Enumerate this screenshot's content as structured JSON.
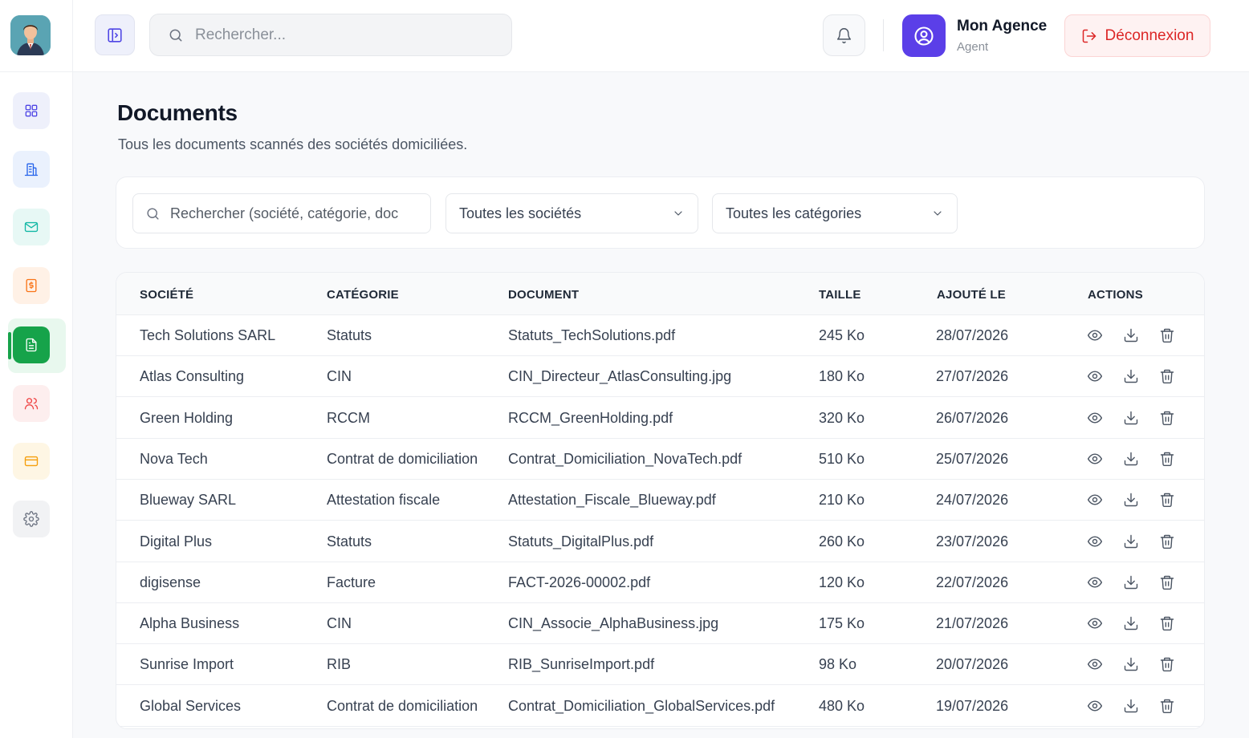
{
  "header": {
    "search_placeholder": "Rechercher...",
    "user_name": "Mon Agence",
    "user_role": "Agent",
    "logout_label": "Déconnexion"
  },
  "sidebar": {
    "items": [
      {
        "name": "dashboard",
        "icon": "grid-icon",
        "color": "#4f46e5",
        "bg": "#eef0fb"
      },
      {
        "name": "companies",
        "icon": "building-icon",
        "color": "#2563eb",
        "bg": "#eaf1fd"
      },
      {
        "name": "mail",
        "icon": "mail-icon",
        "color": "#14b8a6",
        "bg": "#e7f8f5"
      },
      {
        "name": "invoices",
        "icon": "dollar-doc-icon",
        "color": "#f97316",
        "bg": "#fff1e6"
      },
      {
        "name": "documents",
        "icon": "document-icon",
        "color": "#ffffff",
        "bg": "#16a34a",
        "active": true
      },
      {
        "name": "users",
        "icon": "users-icon",
        "color": "#ef4444",
        "bg": "#fdeeee"
      },
      {
        "name": "payments",
        "icon": "card-icon",
        "color": "#f59e0b",
        "bg": "#fef6e4"
      },
      {
        "name": "settings",
        "icon": "gear-icon",
        "color": "#6b7280",
        "bg": "#f1f2f4"
      }
    ]
  },
  "page": {
    "title": "Documents",
    "subtitle": "Tous les documents scannés des sociétés domiciliées."
  },
  "filters": {
    "search_placeholder": "Rechercher (société, catégorie, doc",
    "company_select": "Toutes les sociétés",
    "category_select": "Toutes les catégories"
  },
  "table": {
    "headers": [
      "SOCIÉTÉ",
      "CATÉGORIE",
      "DOCUMENT",
      "TAILLE",
      "AJOUTÉ LE",
      "ACTIONS"
    ],
    "rows": [
      [
        "Tech Solutions SARL",
        "Statuts",
        "Statuts_TechSolutions.pdf",
        "245 Ko",
        "28/07/2026"
      ],
      [
        "Atlas Consulting",
        "CIN",
        "CIN_Directeur_AtlasConsulting.jpg",
        "180 Ko",
        "27/07/2026"
      ],
      [
        "Green Holding",
        "RCCM",
        "RCCM_GreenHolding.pdf",
        "320 Ko",
        "26/07/2026"
      ],
      [
        "Nova Tech",
        "Contrat de domiciliation",
        "Contrat_Domiciliation_NovaTech.pdf",
        "510 Ko",
        "25/07/2026"
      ],
      [
        "Blueway SARL",
        "Attestation fiscale",
        "Attestation_Fiscale_Blueway.pdf",
        "210 Ko",
        "24/07/2026"
      ],
      [
        "Digital Plus",
        "Statuts",
        "Statuts_DigitalPlus.pdf",
        "260 Ko",
        "23/07/2026"
      ],
      [
        "digisense",
        "Facture",
        "FACT-2026-00002.pdf",
        "120 Ko",
        "22/07/2026"
      ],
      [
        "Alpha Business",
        "CIN",
        "CIN_Associe_AlphaBusiness.jpg",
        "175 Ko",
        "21/07/2026"
      ],
      [
        "Sunrise Import",
        "RIB",
        "RIB_SunriseImport.pdf",
        "98 Ko",
        "20/07/2026"
      ],
      [
        "Global Services",
        "Contrat de domiciliation",
        "Contrat_Domiciliation_GlobalServices.pdf",
        "480 Ko",
        "19/07/2026"
      ]
    ]
  },
  "colors": {
    "accent": "#5b3fe8",
    "active_nav": "#16a34a",
    "danger": "#dc2626"
  }
}
